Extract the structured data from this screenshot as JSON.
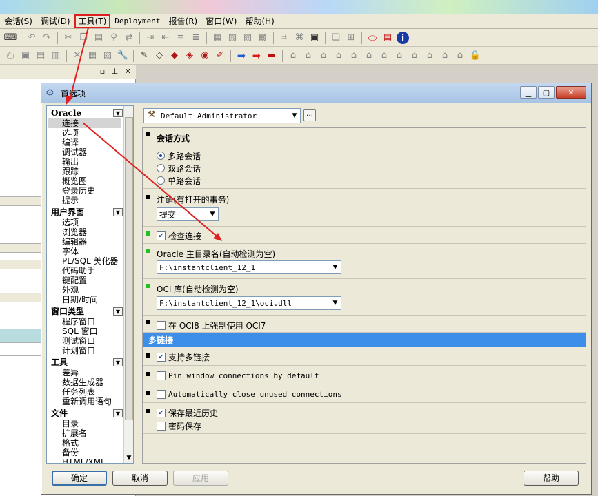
{
  "menu": {
    "items": [
      "会话(S)",
      "调试(D)",
      "工具(T)",
      "Deployment",
      "报告(R)",
      "窗口(W)",
      "帮助(H)"
    ]
  },
  "dialog": {
    "title": "首选项",
    "profile": "Default Administrator",
    "buttons": {
      "ok": "确定",
      "cancel": "取消",
      "apply": "应用",
      "help": "帮助"
    }
  },
  "nav": {
    "groups": [
      {
        "label": "Oracle",
        "items": [
          "连接",
          "选项",
          "编译",
          "调试器",
          "输出",
          "跟踪",
          "概览图",
          "登录历史",
          "提示"
        ]
      },
      {
        "label": "用户界面",
        "items": [
          "选项",
          "浏览器",
          "编辑器",
          "字体",
          "PL/SQL 美化器",
          "代码助手",
          "键配置",
          "外观",
          "日期/时间"
        ]
      },
      {
        "label": "窗口类型",
        "items": [
          "程序窗口",
          "SQL 窗口",
          "测试窗口",
          "计划窗口"
        ]
      },
      {
        "label": "工具",
        "items": [
          "差异",
          "数据生成器",
          "任务列表",
          "重新调用语句"
        ]
      },
      {
        "label": "文件",
        "items": [
          "目录",
          "扩展名",
          "格式",
          "备份",
          "HTML/XML"
        ]
      }
    ],
    "selected": "连接"
  },
  "settings": {
    "session_mode": {
      "title": "会话方式",
      "options": [
        "多路会话",
        "双路会话",
        "单路会话"
      ],
      "selected": "多路会话"
    },
    "logoff": {
      "title": "注销(有打开的事务)",
      "value": "提交"
    },
    "check_connection": {
      "label": "检查连接",
      "checked": true
    },
    "oracle_home": {
      "title": "Oracle 主目录名(自动检测为空)",
      "value": "F:\\instantclient_12_1"
    },
    "oci_library": {
      "title": "OCI 库(自动检测为空)",
      "value": "F:\\instantclient_12_1\\oci.dll"
    },
    "force_oci7": {
      "label": "在 OCI8 上强制使用 OCI7",
      "checked": false
    },
    "multi_connection": {
      "header": "多链接",
      "support": {
        "label": "支持多链接",
        "checked": true
      },
      "pin_window": {
        "label": "Pin window connections by default",
        "checked": false
      },
      "auto_close": {
        "label": "Automatically close unused connections",
        "checked": false
      },
      "save_history": {
        "label": "保存最近历史",
        "checked": true
      },
      "save_password": {
        "label": "密码保存",
        "checked": false
      }
    }
  },
  "colors": {
    "header_band": "#3d8ee8",
    "annotation": "#e02020",
    "marker_green": "#20c020"
  }
}
